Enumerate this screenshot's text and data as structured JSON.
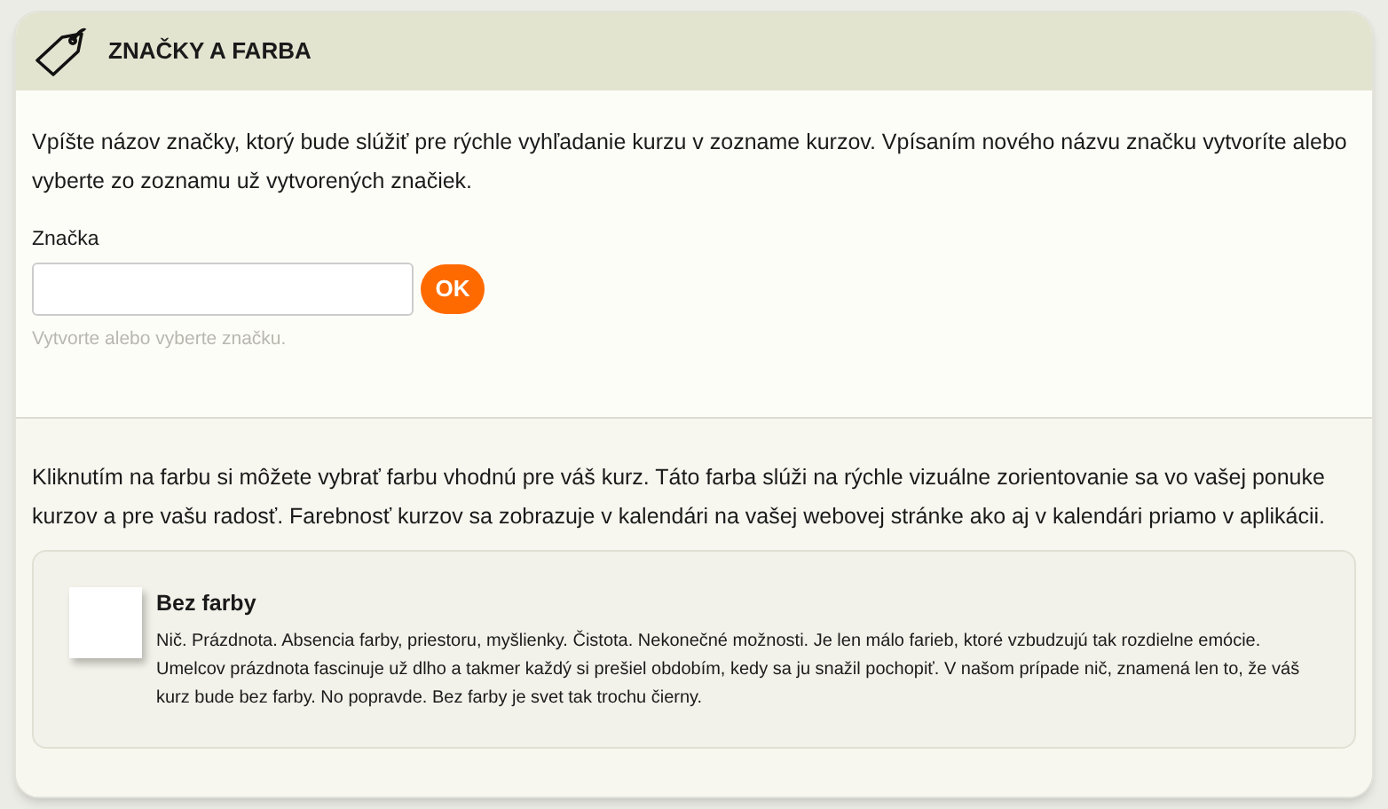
{
  "header": {
    "title": "ZNAČKY A FARBA"
  },
  "tag_section": {
    "intro": "Vpíšte názov značky, ktorý bude slúžiť pre rýchle vyhľadanie kurzu v zozname kurzov. Vpísaním nového názvu značku vytvoríte alebo vyberte zo zoznamu už vytvorených značiek.",
    "field_label": "Značka",
    "button": "OK",
    "hint": "Vytvorte alebo vyberte značku."
  },
  "color_section": {
    "intro": "Kliknutím na farbu si môžete vybrať farbu vhodnú pre váš kurz. Táto farba slúži na rýchle vizuálne zorientovanie sa vo vašej ponuke kurzov a pre vašu radosť. Farebnosť kurzov sa zobrazuje v kalendári na vašej webovej stránke ako aj v kalendári priamo v aplikácii.",
    "options": [
      {
        "name": "Bez farby",
        "color": "#ffffff",
        "description": "Nič. Prázdnota. Absencia farby, priestoru, myšlienky. Čistota. Nekonečné možnosti. Je len málo farieb, ktoré vzbudzujú tak rozdielne emócie. Umelcov prázdnota fascinuje už dlho a takmer každý si prešiel obdobím, kedy sa ju snažil pochopiť. V našom prípade nič, znamená len to, že váš kurz bude bez farby. No popravde. Bez farby je svet tak trochu čierny."
      }
    ]
  }
}
